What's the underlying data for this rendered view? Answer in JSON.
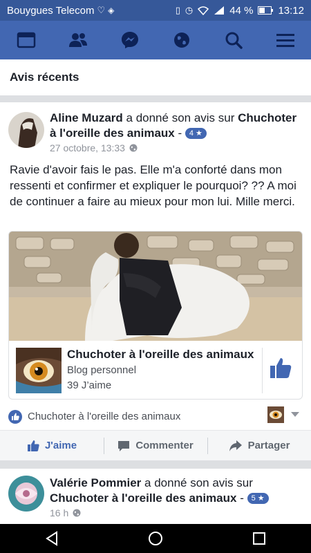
{
  "status": {
    "carrier": "Bouygues Telecom",
    "battery": "44 %",
    "time": "13:12"
  },
  "section": {
    "title": "Avis récents"
  },
  "post1": {
    "author": "Aline Muzard",
    "verb": " a donné son avis sur ",
    "page": "Chuchoter à l'oreille des animaux",
    "rating": "4 ★",
    "time": "27 octobre, 13:33",
    "body": "Ravie d'avoir fais le pas. Elle m'a conforté dans mon ressenti et confirmer et expliquer le pourquoi? ?? A moi de continuer a faire au mieux pour mon lui. Mille merci.",
    "card": {
      "title": "Chuchoter à l'oreille des animaux",
      "subtitle": "Blog personnel",
      "likes": "39 J’aime"
    },
    "attribution": "Chuchoter à l'oreille des animaux"
  },
  "actions": {
    "like": "J'aime",
    "comment": "Commenter",
    "share": "Partager"
  },
  "post2": {
    "author": "Valérie Pommier",
    "verb": " a donné son avis sur ",
    "page": "Chuchoter à l'oreille des animaux",
    "rating": "5 ★",
    "time": "16 h"
  },
  "colors": {
    "brand": "#4267b2",
    "statusbar": "#365899",
    "text": "#1d2129",
    "muted": "#90949c"
  },
  "icons": [
    "heart-icon",
    "shield-icon",
    "vibrate-icon",
    "alarm-icon",
    "wifi-icon",
    "signal-icon",
    "battery-icon",
    "news-feed-icon",
    "friends-icon",
    "messenger-icon",
    "globe-icon",
    "search-icon",
    "menu-icon",
    "thumbs-up-icon",
    "comment-icon",
    "share-icon",
    "back-icon",
    "home-icon",
    "recents-icon"
  ]
}
